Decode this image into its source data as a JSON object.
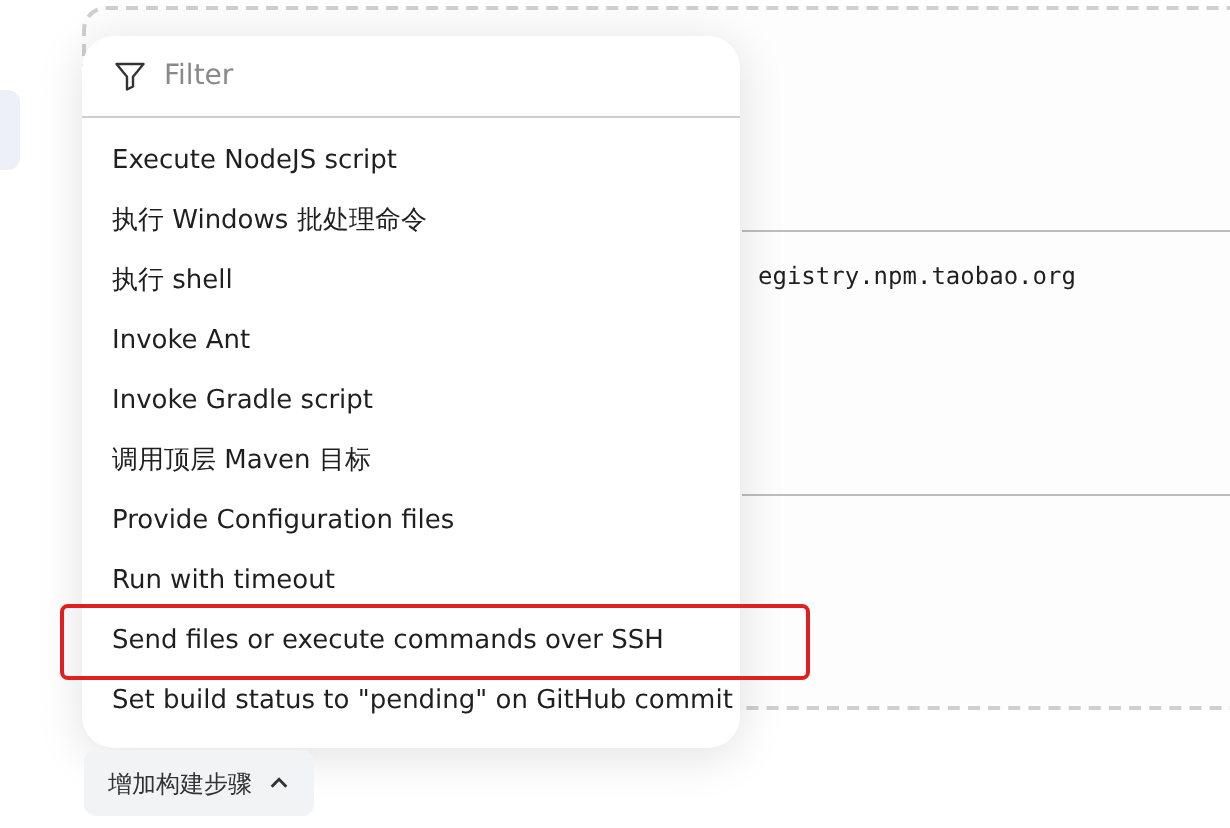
{
  "background": {
    "code_text": "egistry.npm.taobao.org"
  },
  "menu": {
    "filter": {
      "placeholder": "Filter"
    },
    "items": [
      {
        "label": "Execute NodeJS script",
        "highlighted": false
      },
      {
        "label": "执行 Windows 批处理命令",
        "highlighted": false
      },
      {
        "label": "执行 shell",
        "highlighted": false
      },
      {
        "label": "Invoke Ant",
        "highlighted": false
      },
      {
        "label": "Invoke Gradle script",
        "highlighted": false
      },
      {
        "label": "调用顶层 Maven 目标",
        "highlighted": false
      },
      {
        "label": "Provide Configuration files",
        "highlighted": false
      },
      {
        "label": "Run with timeout",
        "highlighted": false
      },
      {
        "label": "Send files or execute commands over SSH",
        "highlighted": true
      },
      {
        "label": "Set build status to \"pending\" on GitHub commit",
        "highlighted": false
      }
    ]
  },
  "add_step_button": {
    "label": "增加构建步骤",
    "expanded": true
  }
}
